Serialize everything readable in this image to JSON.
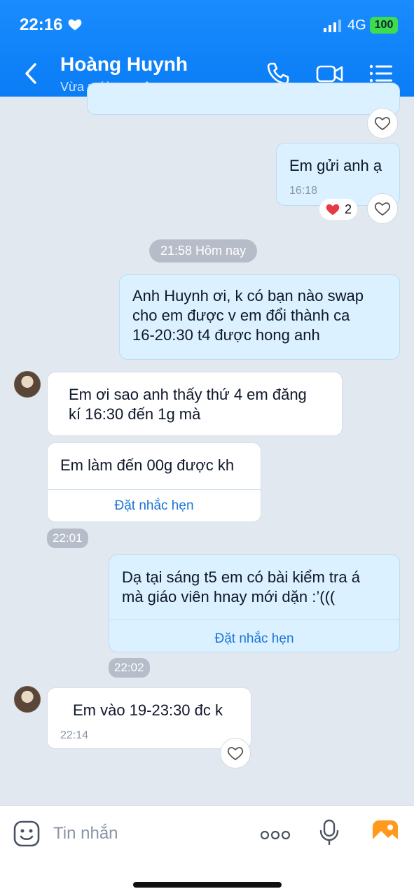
{
  "status_bar": {
    "time": "22:16",
    "network": "4G",
    "battery": "100"
  },
  "header": {
    "contact_name": "Hoàng Huynh",
    "contact_status": "Vừa mới truy cập"
  },
  "messages": {
    "m1": {
      "text": "Em gửi anh ạ",
      "time": "16:18",
      "reaction_count": "2"
    },
    "date_separator": "21:58 Hôm nay",
    "m2": {
      "text": "Anh Huynh ơi, k có bạn nào swap\ncho em được v em đổi thành ca\n16-20:30 t4 được hong anh"
    },
    "m3": {
      "text": "Em ơi sao anh thấy thứ 4 em đăng\nkí 16:30 đến 1g mà"
    },
    "m4": {
      "text": "Em làm đến 00g được kh",
      "reminder": "Đặt nhắc hẹn",
      "time": "22:01"
    },
    "m5": {
      "text": "Dạ tại sáng t5 em có bài kiểm tra á\nmà giáo viên hnay mới dặn :’(((",
      "reminder": "Đặt nhắc hẹn",
      "time": "22:02"
    },
    "m6": {
      "text": "Em vào 19-23:30 đc k",
      "time": "22:14"
    }
  },
  "input": {
    "placeholder": "Tin nhắn"
  },
  "colors": {
    "header_blue": "#0a7cf5",
    "outgoing_bubble": "#dbf1ff",
    "chat_bg": "#e2e8f0",
    "link_blue": "#1a73d9"
  },
  "icons": [
    "heart-icon",
    "signal-icon",
    "back-icon",
    "phone-icon",
    "video-icon",
    "menu-icon",
    "avatar",
    "emoji-icon",
    "more-icon",
    "mic-icon",
    "image-icon"
  ]
}
